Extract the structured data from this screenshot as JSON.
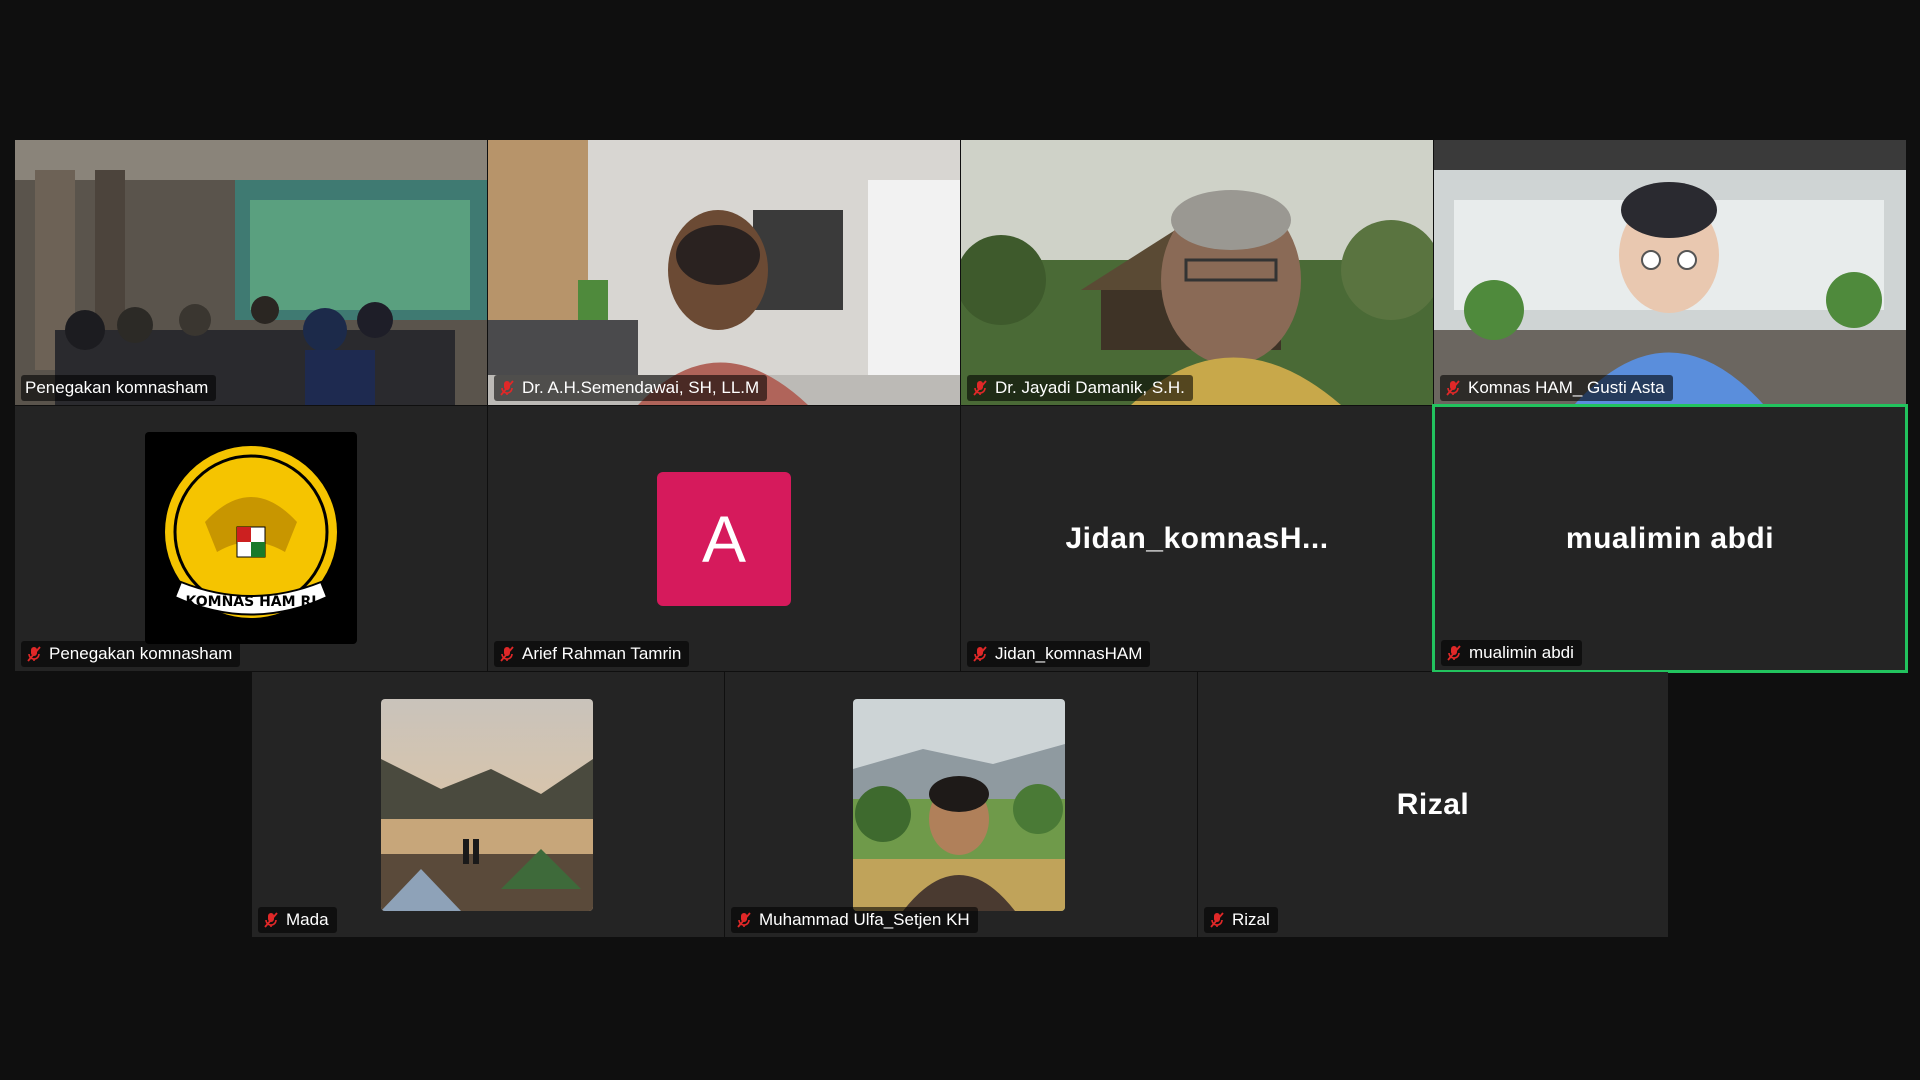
{
  "participants": [
    {
      "name": "Penegakan komnasham",
      "muted": false,
      "type": "video",
      "icon": "meeting-room-video"
    },
    {
      "name": "Dr. A.H.Semendawai, SH, LL.M",
      "muted": true,
      "type": "video",
      "icon": "office-background-video"
    },
    {
      "name": "Dr. Jayadi Damanik, S.H.",
      "muted": true,
      "type": "video",
      "icon": "traditional-house-background-video"
    },
    {
      "name": "Komnas HAM_ Gusti Asta",
      "muted": true,
      "type": "video",
      "icon": "avatar-office-video"
    },
    {
      "name": "Penegakan komnasham",
      "muted": true,
      "type": "profile-image",
      "icon": "komnas-ham-logo"
    },
    {
      "name": "Arief Rahman Tamrin",
      "muted": true,
      "type": "letter-avatar",
      "initial": "A",
      "avatar_color": "#d61a5c"
    },
    {
      "name": "Jidan_komnasHAM",
      "display": "Jidan_komnasH...",
      "muted": true,
      "type": "name-only"
    },
    {
      "name": "mualimin abdi",
      "display": "mualimin abdi",
      "muted": true,
      "type": "name-only",
      "active_speaker": true
    },
    {
      "name": "Mada",
      "muted": true,
      "type": "profile-image",
      "icon": "lake-tent-photo"
    },
    {
      "name": "Muhammad Ulfa_Setjen KH",
      "muted": true,
      "type": "profile-image",
      "icon": "person-rice-field-photo"
    },
    {
      "name": "Rizal",
      "display": "Rizal",
      "muted": true,
      "type": "name-only"
    }
  ],
  "colors": {
    "active_border": "#22c35e",
    "tile_bg": "#242424",
    "page_bg": "#0f0f0f",
    "mic_muted": "#e02828"
  }
}
